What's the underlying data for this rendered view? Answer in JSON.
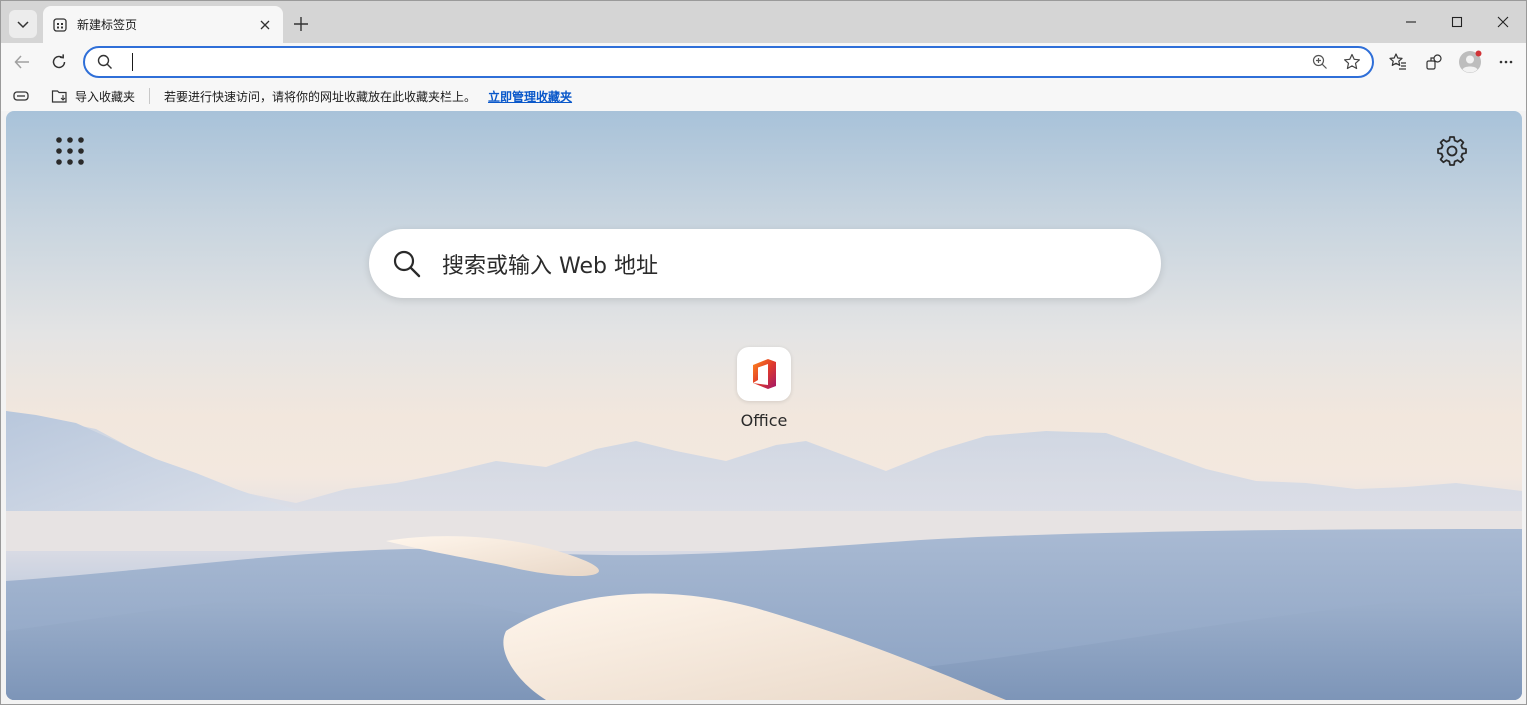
{
  "tab": {
    "title": "新建标签页"
  },
  "address_bar": {
    "value": "",
    "placeholder": ""
  },
  "favorites_bar": {
    "import_label": "导入收藏夹",
    "hint": "若要进行快速访问，请将你的网址收藏放在此收藏夹栏上。",
    "manage_link": "立即管理收藏夹"
  },
  "new_tab_page": {
    "search_placeholder": "搜索或输入 Web 地址",
    "tiles": [
      {
        "label": "Office"
      }
    ]
  },
  "icons": {
    "tab_menu": "chevron-down-icon",
    "favicon": "newtab-icon",
    "close_tab": "close-icon",
    "new_tab": "plus-icon",
    "back": "arrow-left-icon",
    "refresh": "refresh-icon",
    "search": "search-icon",
    "zoom": "zoom-in-icon",
    "favorite": "star-icon",
    "favorites": "favorites-icon",
    "extensions": "extensions-icon",
    "profile": "avatar",
    "more": "more-icon",
    "apps": "app-launcher-icon",
    "settings": "gear-icon"
  },
  "colors": {
    "accent": "#2f6fd8",
    "link": "#0a58ca",
    "notification_dot": "#d13438"
  }
}
